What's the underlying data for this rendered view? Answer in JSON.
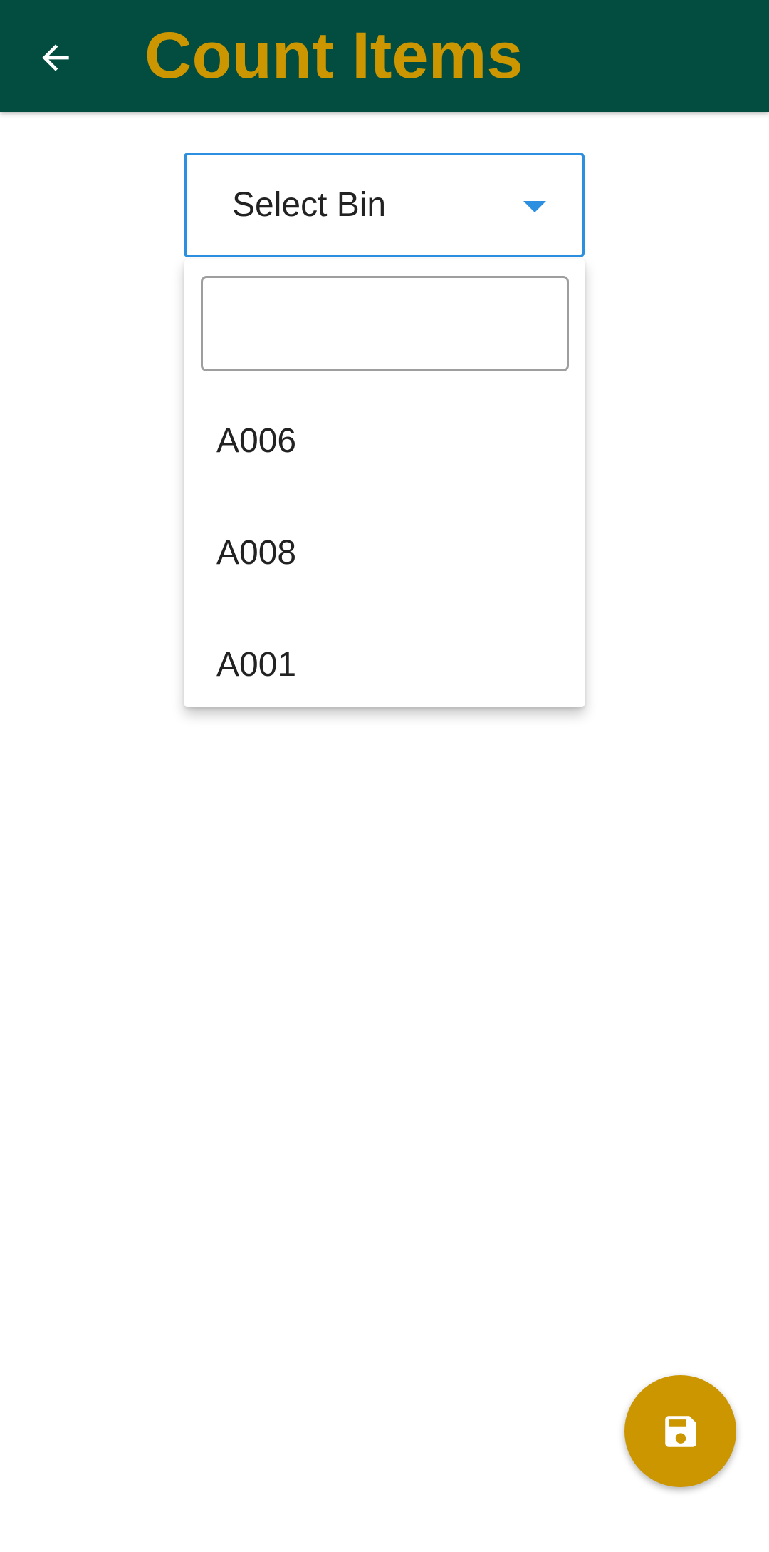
{
  "app_bar": {
    "title": "Count Items",
    "back_icon": "arrow-back-icon",
    "background_color": "#024d40",
    "title_color": "#cc9600"
  },
  "bin_select": {
    "label": "Select Bin",
    "caret_icon": "caret-down-icon",
    "accent_color": "#2d8fe0"
  },
  "dropdown": {
    "search": {
      "value": "",
      "placeholder": ""
    },
    "options": [
      {
        "label": "A006"
      },
      {
        "label": "A008"
      },
      {
        "label": "A001"
      }
    ]
  },
  "fab": {
    "icon": "save-icon",
    "color": "#cc9600"
  }
}
